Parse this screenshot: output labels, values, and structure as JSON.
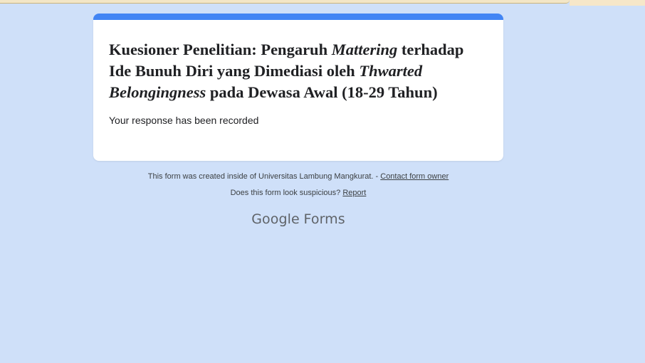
{
  "form": {
    "title_parts": {
      "p1": "Kuesioner Penelitian: Pengaruh ",
      "p2": "Mattering",
      "p3": " terhadap Ide Bunuh Diri yang Dimediasi oleh ",
      "p4": "Thwarted Belongingness",
      "p5": " pada Dewasa Awal (18-29 Tahun)"
    },
    "status": "Your response has been recorded"
  },
  "footer": {
    "created_text": "This form was created inside of Universitas Lambung Mangkurat. - ",
    "contact_link": "Contact form owner",
    "suspicious_text": "Does this form look suspicious? ",
    "report_link": "Report"
  },
  "brand": {
    "google": "Google",
    "forms": "Forms"
  },
  "colors": {
    "background": "#cfe0f9",
    "accent": "#4285f4",
    "card": "#ffffff"
  }
}
